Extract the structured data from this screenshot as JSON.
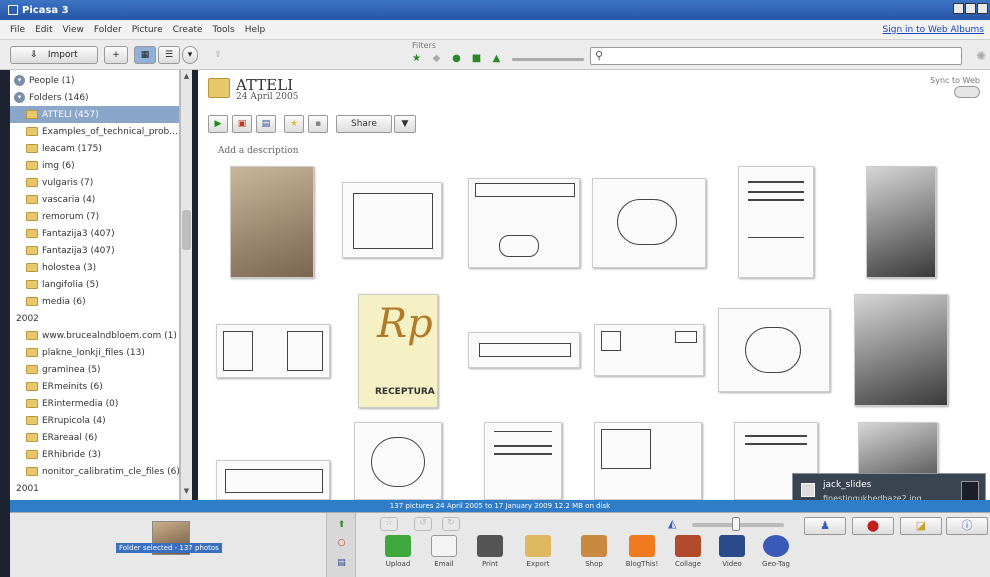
{
  "window": {
    "title": "Picasa 3"
  },
  "menu": {
    "items": [
      "File",
      "Edit",
      "View",
      "Folder",
      "Picture",
      "Create",
      "Tools",
      "Help"
    ],
    "signin": "Sign in to Web Albums"
  },
  "toolbar": {
    "import_label": "Import",
    "filters_label": "Filters"
  },
  "left_panel": {
    "people": "People (1)",
    "folders": "Folders (146)",
    "items": [
      "ATTELI (457)",
      "Examples_of_technical_prob...",
      "leacam (175)",
      "img (6)",
      "vulgaris (7)",
      "vascaria (4)",
      "remorum (7)",
      "Fantazija3 (407)",
      "Fantazija3 (407)",
      "holostea (3)",
      "langifolia (5)",
      "media (6)"
    ],
    "year_2002": "2002",
    "items_2002": [
      "www.brucealndbloem.com (1)",
      "plakne_lonkji_files (13)",
      "graminea (5)",
      "ERmeinits (6)",
      "ERintermedia (0)",
      "ERrupicola (4)",
      "ERareaal (6)",
      "ERhibride (3)",
      "nonitor_calibratim_cle_files (6)"
    ],
    "year_2001": "2001"
  },
  "album": {
    "title": "ATTELI",
    "date": "24 April 2005",
    "share_label": "Share",
    "add_description": "Add a description",
    "sync_label": "Sync to Web"
  },
  "thumbnails": [
    {
      "kind": "sepia"
    },
    {
      "kind": "diagram"
    },
    {
      "kind": "diagram"
    },
    {
      "kind": "diagram"
    },
    {
      "kind": "doc"
    },
    {
      "kind": "bw"
    },
    {
      "kind": "diagram"
    },
    {
      "kind": "rp"
    },
    {
      "kind": "diagram"
    },
    {
      "kind": "diagram"
    },
    {
      "kind": "diagram"
    },
    {
      "kind": "bw"
    },
    {
      "kind": "diagram"
    },
    {
      "kind": "diagram"
    },
    {
      "kind": "doc"
    },
    {
      "kind": "diagram"
    },
    {
      "kind": "doc"
    },
    {
      "kind": "bw"
    }
  ],
  "rp_thumb": {
    "big": "Rp",
    "caption": "RECEPTURA"
  },
  "notifier": {
    "title": "jack_slides",
    "subtitle": "finestingukhedbaze2.jpg"
  },
  "status": "137 pictures    24 April 2005 to 17 January 2009    12.2 MB on disk",
  "tray": {
    "label": "Folder selected - 137 photos"
  },
  "actions": [
    "Upload",
    "Email",
    "Print",
    "Export",
    "Shop",
    "BlogThis!",
    "Collage",
    "Video",
    "Geo-Tag"
  ],
  "colors": {
    "titlebar": "#2f62b5",
    "selection": "#8aa6c8",
    "status_bar": "#2f7cc8"
  }
}
